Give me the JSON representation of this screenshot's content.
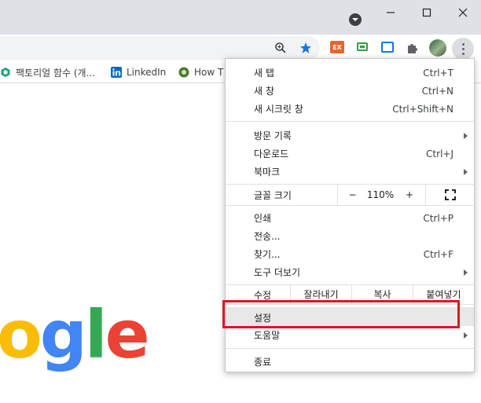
{
  "window": {
    "controls": [
      "minimize",
      "maximize",
      "close"
    ]
  },
  "toolbar": {
    "icons": [
      "zoom-icon",
      "bookmark-star-icon",
      "extension-ex-icon",
      "extension-green-icon",
      "extension-blue-icon",
      "extensions-puzzle-icon",
      "profile-avatar",
      "menu-kebab-icon"
    ],
    "ext_ex_label": "EX"
  },
  "bookmarks": [
    {
      "label": "팩토리얼 함수 (개...",
      "icon": "hex-icon"
    },
    {
      "label": "LinkedIn",
      "icon": "linkedin-icon"
    },
    {
      "label": "How T",
      "icon": "gear-badge-icon"
    }
  ],
  "menu": {
    "items_top": [
      {
        "label": "새 탭",
        "shortcut": "Ctrl+T"
      },
      {
        "label": "새 창",
        "shortcut": "Ctrl+N"
      },
      {
        "label": "새 시크릿 창",
        "shortcut": "Ctrl+Shift+N"
      }
    ],
    "items_history": [
      {
        "label": "방문 기록",
        "shortcut": "",
        "submenu": true
      },
      {
        "label": "다운로드",
        "shortcut": "Ctrl+J",
        "submenu": false
      },
      {
        "label": "북마크",
        "shortcut": "",
        "submenu": true
      }
    ],
    "zoom": {
      "label": "글꼴 크기",
      "minus": "−",
      "value": "110%",
      "plus": "+"
    },
    "items_tools": [
      {
        "label": "인쇄",
        "shortcut": "Ctrl+P",
        "submenu": false
      },
      {
        "label": "전송...",
        "shortcut": "",
        "submenu": false
      },
      {
        "label": "찾기...",
        "shortcut": "Ctrl+F",
        "submenu": false
      },
      {
        "label": "도구 더보기",
        "shortcut": "",
        "submenu": true
      }
    ],
    "edit": {
      "label": "수정",
      "cut": "잘라내기",
      "copy": "복사",
      "paste": "붙여넣기"
    },
    "settings": "설정",
    "help": "도움말",
    "exit": "종료"
  },
  "logo": {
    "letters": [
      {
        "ch": "o",
        "color": "#fbbc05"
      },
      {
        "ch": "g",
        "color": "#4285f4"
      },
      {
        "ch": "l",
        "color": "#34a853"
      },
      {
        "ch": "e",
        "color": "#ea4335"
      }
    ]
  },
  "colors": {
    "highlight": "#e0161f",
    "accent": "#1a73e8"
  }
}
